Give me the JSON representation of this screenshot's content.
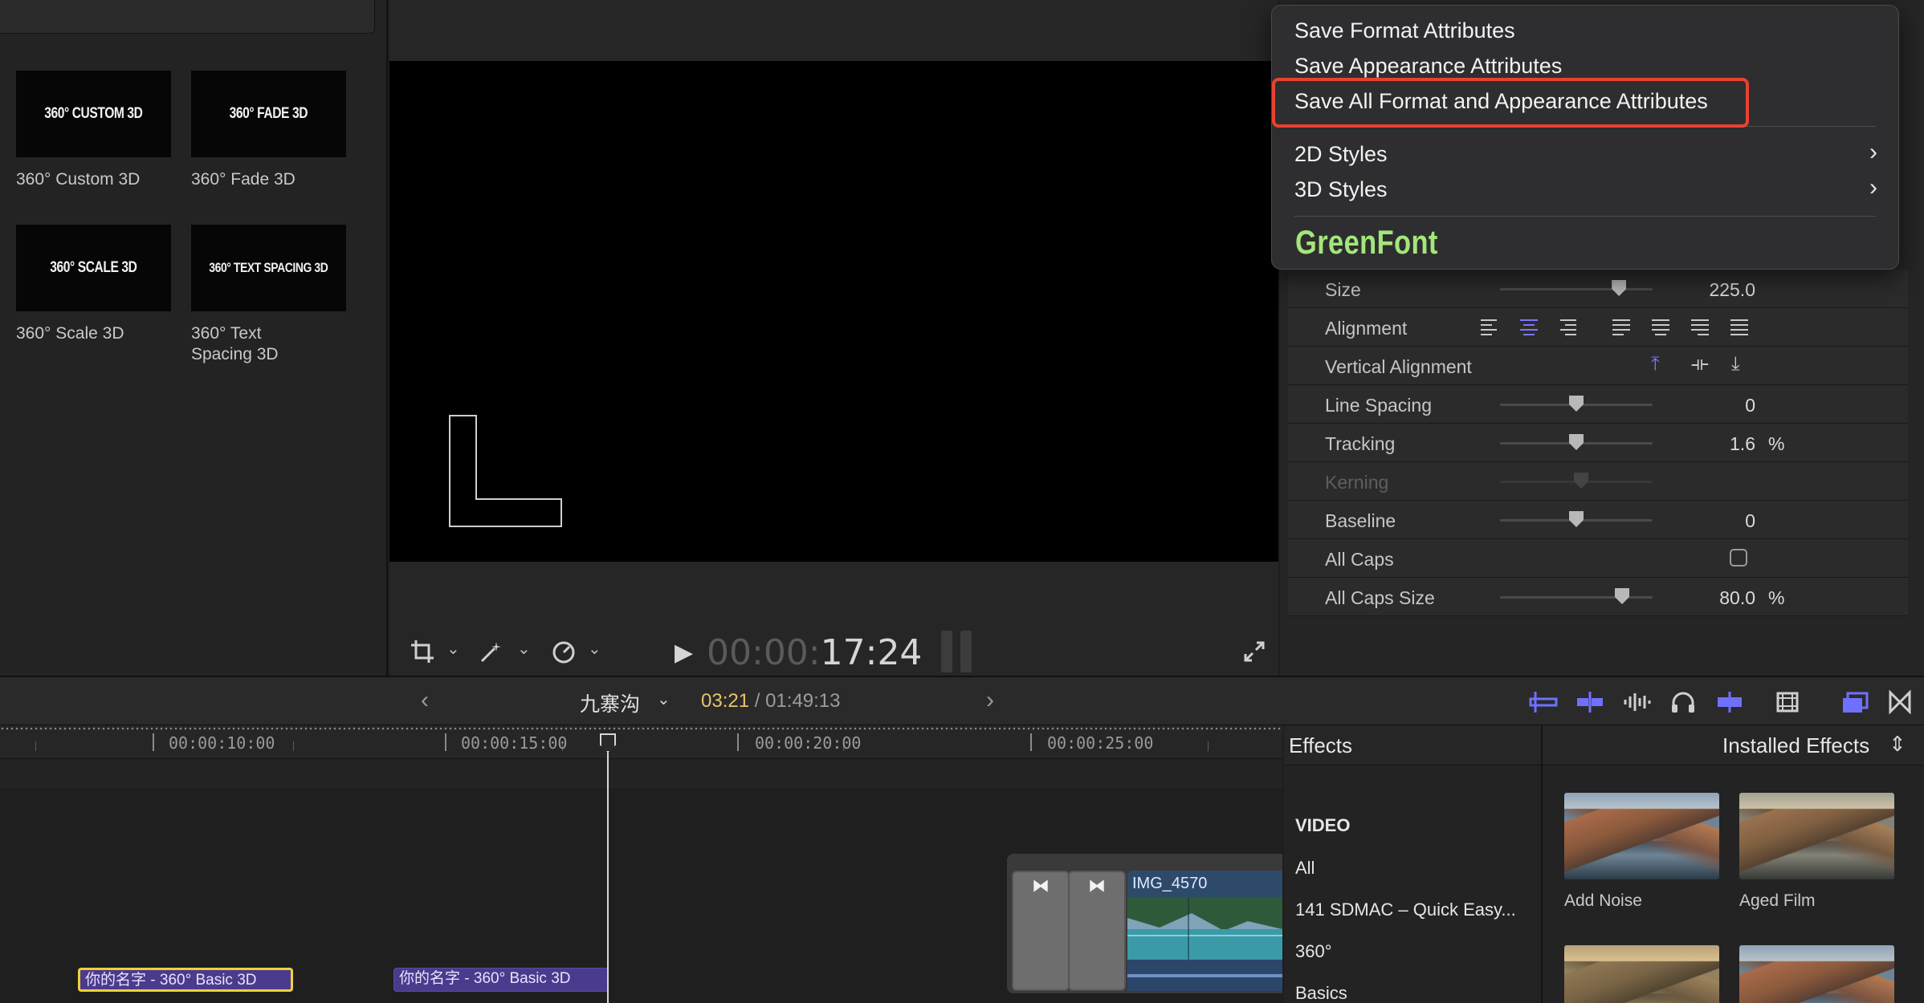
{
  "browser": {
    "tiles": [
      {
        "thumb": "360° CUSTOM 3D",
        "label": "360° Custom 3D"
      },
      {
        "thumb": "360° FADE 3D",
        "label": "360° Fade 3D"
      },
      {
        "thumb": "360° SCALE 3D",
        "label": "360° Scale 3D"
      },
      {
        "thumb": "360° TEXT SPACING 3D",
        "label_line1": "360° Text",
        "label_line2": "Spacing 3D"
      }
    ]
  },
  "viewer": {
    "timecode_dim": "00:00:",
    "timecode_bright": "17:24",
    "canvas_glyph": "L"
  },
  "context_menu": {
    "items": [
      "Save Format Attributes",
      "Save Appearance Attributes",
      "Save All Format and Appearance Attributes"
    ],
    "submenus": [
      "2D Styles",
      "3D Styles"
    ],
    "font_name": "GreenFont",
    "highlight_color": "#e8422f",
    "font_color": "#a4e67a"
  },
  "inspector": {
    "size": {
      "label": "Size",
      "value": "225.0",
      "level": 0.78
    },
    "alignment": {
      "label": "Alignment"
    },
    "vertical_alignment": {
      "label": "Vertical Alignment"
    },
    "line_spacing": {
      "label": "Line Spacing",
      "value": "0",
      "level": 0.5
    },
    "tracking": {
      "label": "Tracking",
      "value": "1.6",
      "unit": "%",
      "level": 0.5
    },
    "kerning": {
      "label": "Kerning"
    },
    "baseline": {
      "label": "Baseline",
      "value": "0",
      "level": 0.5
    },
    "all_caps": {
      "label": "All Caps",
      "checked": false
    },
    "all_caps_size": {
      "label": "All Caps Size",
      "value": "80.0",
      "unit": "%",
      "level": 0.8
    },
    "accent_color": "#7a77ff"
  },
  "timeline": {
    "project_name": "九寨沟",
    "current": "03:21",
    "separator": " / ",
    "total": "01:49:13",
    "ruler": [
      "00:00:10:00",
      "00:00:15:00",
      "00:00:20:00",
      "00:00:25:00"
    ],
    "clip_name": "IMG_4570",
    "title_clips": [
      "你的名字 - 360° Basic 3D",
      "你的名字 - 360° Basic 3D"
    ]
  },
  "effects": {
    "title": "Effects",
    "source": "Installed Effects",
    "categories": [
      "VIDEO",
      "All",
      "141 SDMAC – Quick Easy...",
      "360°",
      "Basics"
    ],
    "items": [
      "Add Noise",
      "Aged Film"
    ]
  }
}
